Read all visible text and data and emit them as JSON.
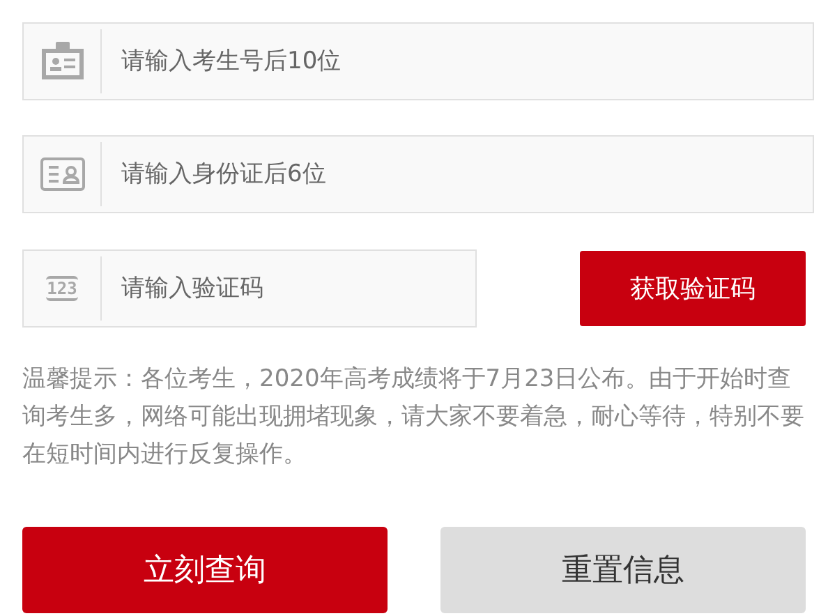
{
  "fields": [
    {
      "kind": "badge",
      "placeholder": "请输入考生号后10位"
    },
    {
      "kind": "idcard",
      "placeholder": "请输入身份证后6位"
    }
  ],
  "captcha": {
    "icon_text": "123",
    "placeholder": "请输入验证码",
    "button": "获取验证码"
  },
  "notice": "温馨提示：各位考生，2020年高考成绩将于7月23日公布。由于开始时查询考生多，网络可能出现拥堵现象，请大家不要着急，耐心等待，特别不要在短时间内进行反复操作。",
  "buttons": [
    {
      "kind": "primary",
      "label": "立刻查询"
    },
    {
      "kind": "secondary",
      "label": "重置信息"
    }
  ]
}
